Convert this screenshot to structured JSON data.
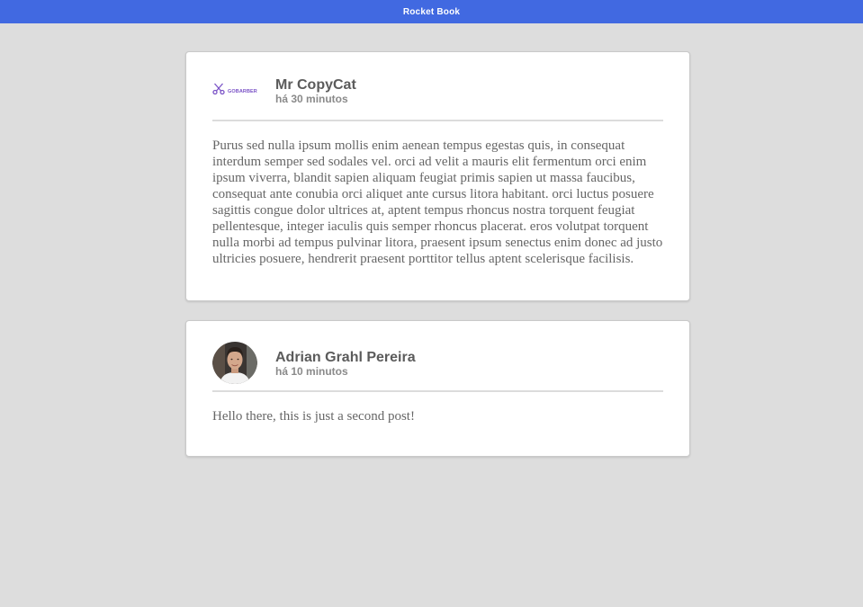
{
  "header": {
    "title": "Rocket Book"
  },
  "colors": {
    "topbar": "#4169e1",
    "background": "#dddddd",
    "card": "#ffffff"
  },
  "posts": [
    {
      "author": "Mr CopyCat",
      "time": "há 30 minutos",
      "avatar_icon": "scissors-icon",
      "avatar_logo_text": "GOBARBER",
      "content": "Purus sed nulla ipsum mollis enim aenean tempus egestas quis, in consequat interdum semper sed sodales vel. orci ad velit a mauris elit fermentum orci enim ipsum viverra, blandit sapien aliquam feugiat primis sapien ut massa faucibus, consequat ante conubia orci aliquet ante cursus litora habitant. orci luctus posuere sagittis congue dolor ultrices at, aptent tempus rhoncus nostra torquent feugiat pellentesque, integer iaculis quis semper rhoncus placerat. eros volutpat torquent nulla morbi ad tempus pulvinar litora, praesent ipsum senectus enim donec ad justo ultricies posuere, hendrerit praesent porttitor tellus aptent scelerisque facilisis."
    },
    {
      "author": "Adrian Grahl Pereira",
      "time": "há 10 minutos",
      "avatar_icon": "user-photo-icon",
      "content": "Hello there, this is just a second post!"
    }
  ]
}
